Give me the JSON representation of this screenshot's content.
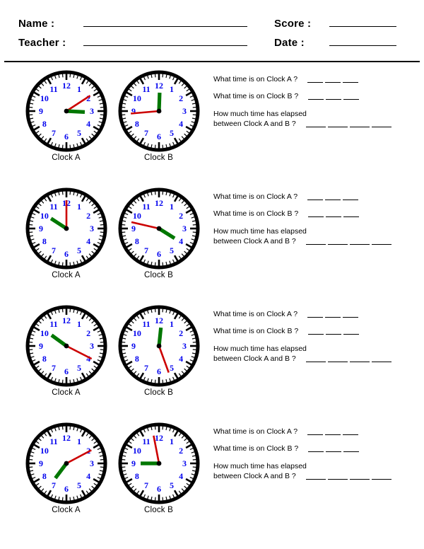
{
  "header": {
    "name_label": "Name :",
    "teacher_label": "Teacher :",
    "score_label": "Score :",
    "date_label": "Date :",
    "name_value": "",
    "teacher_value": "",
    "score_value": "",
    "date_value": ""
  },
  "questions": {
    "clock_a_question": "What time is on Clock A ?",
    "clock_b_question": "What time is on Clock B ?",
    "elapsed_line1": "How much time has elapsed",
    "elapsed_line2": "between Clock A and B  ?"
  },
  "labels": {
    "clock_a": "Clock A",
    "clock_b": "Clock B"
  },
  "colors": {
    "numerals": "#0000ee",
    "hour_hand": "#007700",
    "minute_hand": "#cc0000",
    "rim": "#000000",
    "face": "#ffffff"
  },
  "clock_face": {
    "numerals": [
      "12",
      "1",
      "2",
      "3",
      "4",
      "5",
      "6",
      "7",
      "8",
      "9",
      "10",
      "11"
    ],
    "hour_ticks": 12,
    "minute_ticks": 60
  },
  "rows": [
    {
      "clock_a": {
        "hour_angle": 93,
        "minute_angle": 57
      },
      "clock_b": {
        "hour_angle": 2,
        "minute_angle": 265
      }
    },
    {
      "clock_a": {
        "hour_angle": 303,
        "minute_angle": 0
      },
      "clock_b": {
        "hour_angle": 122,
        "minute_angle": 283
      }
    },
    {
      "clock_a": {
        "hour_angle": 306,
        "minute_angle": 117
      },
      "clock_b": {
        "hour_angle": 6,
        "minute_angle": 160
      }
    },
    {
      "clock_a": {
        "hour_angle": 217,
        "minute_angle": 62
      },
      "clock_b": {
        "hour_angle": 270,
        "minute_angle": 349
      }
    }
  ]
}
